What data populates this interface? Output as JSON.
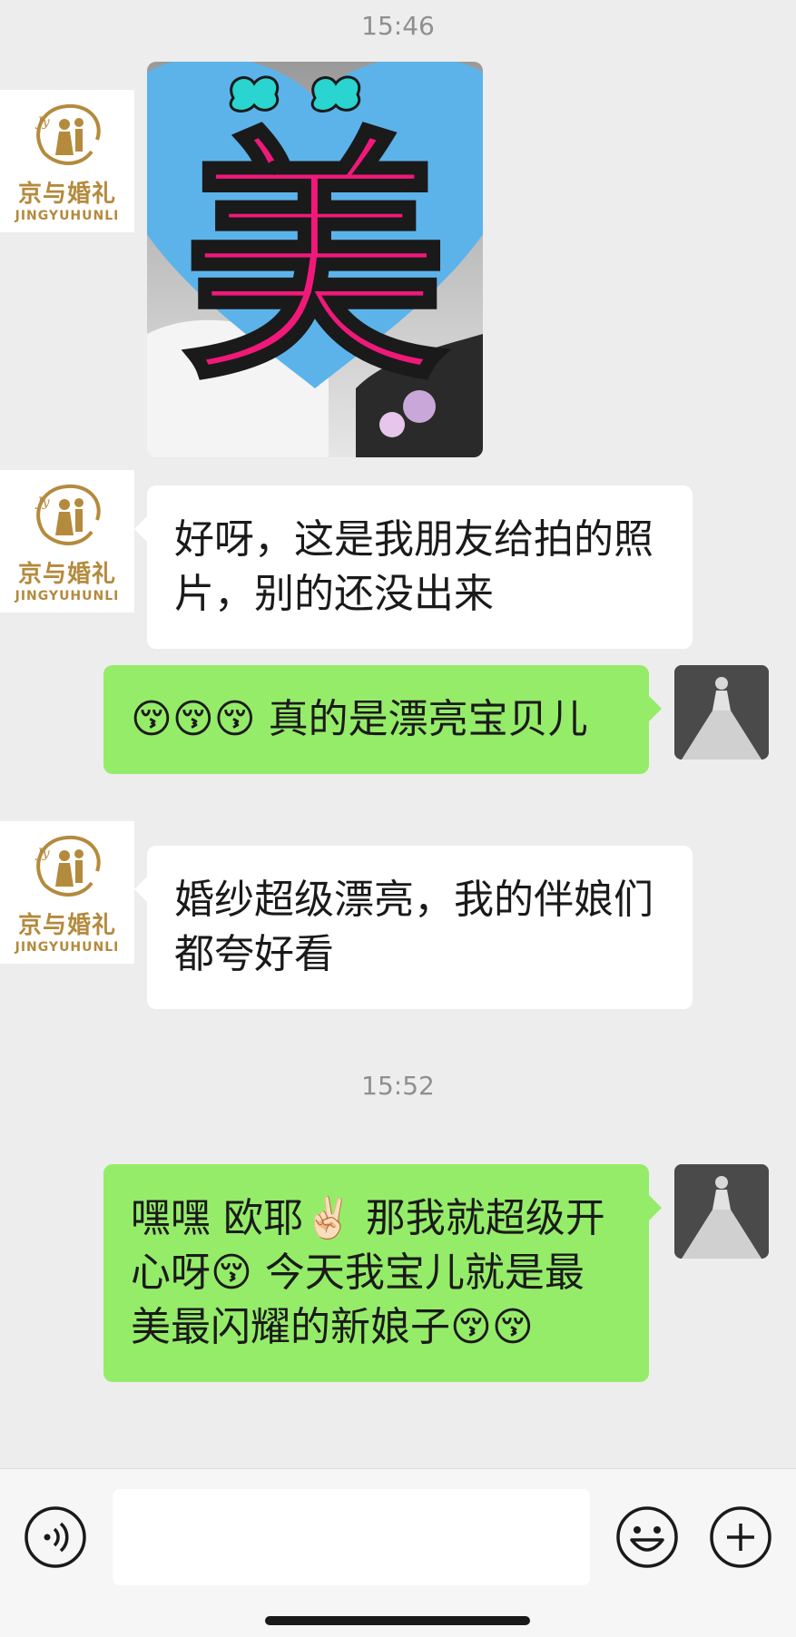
{
  "timestamps": [
    "15:46",
    "15:52"
  ],
  "contact": {
    "brand_cn": "京与婚礼",
    "brand_en": "JINGYUHUNLI"
  },
  "image_message": {
    "sticker_char": "美"
  },
  "messages": [
    {
      "side": "in",
      "text": "好呀，这是我朋友给拍的照片，别的还没出来"
    },
    {
      "side": "out",
      "text": "😚😚😚 真的是漂亮宝贝儿"
    },
    {
      "side": "in",
      "text": "婚纱超级漂亮，我的伴娘们都夸好看"
    },
    {
      "side": "out",
      "text": "嘿嘿 欧耶✌🏻 那我就超级开心呀😚  今天我宝儿就是最美最闪耀的新娘子😚😚"
    }
  ],
  "input": {
    "value": "",
    "voice_icon": "voice-icon",
    "emoji_icon": "emoji-icon",
    "plus_icon": "plus-icon"
  },
  "colors": {
    "background": "#ededed",
    "bubble_out": "#95ec69",
    "bubble_in": "#ffffff",
    "brand_gold": "#b48a3c",
    "sticker_pink": "#f0197a",
    "sticker_blue": "#5cb3ea"
  }
}
